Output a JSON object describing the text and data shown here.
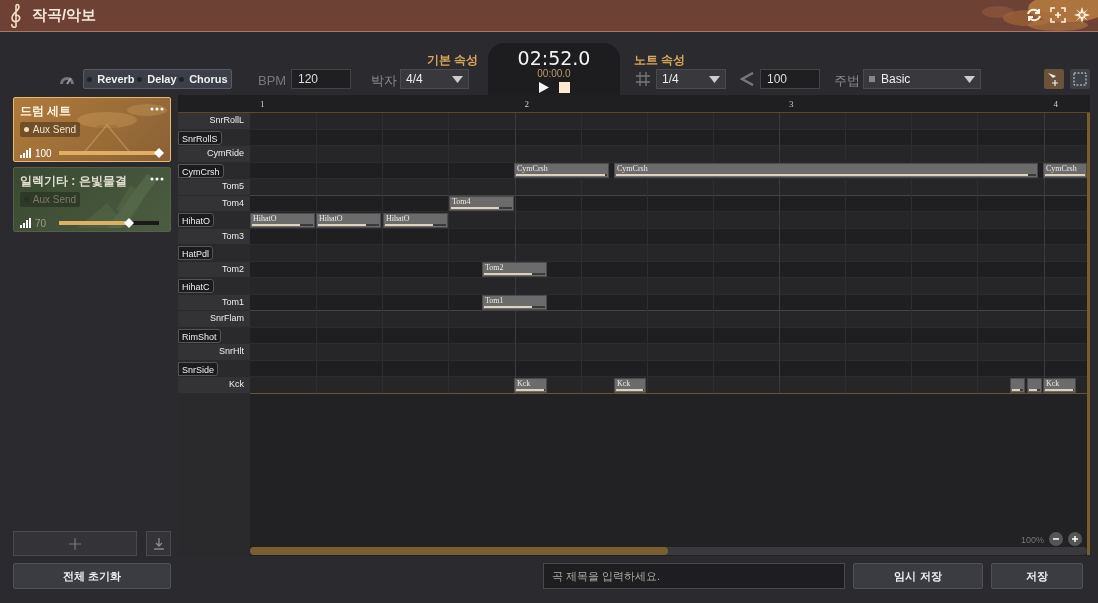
{
  "window": {
    "title": "작곡/악보"
  },
  "effects": [
    {
      "label": "Reverb",
      "on": false
    },
    {
      "label": "Delay",
      "on": false
    },
    {
      "label": "Chorus",
      "on": false
    }
  ],
  "bpm": {
    "label": "BPM",
    "value": "120"
  },
  "meter": {
    "label": "박자",
    "value": "4/4"
  },
  "basic_header": "기본 속성",
  "transport": {
    "time": "02:52.0",
    "position": "00:00.0"
  },
  "note_header": "노트 속성",
  "grid_value": "1/4",
  "velocity": "100",
  "technique": {
    "label": "주법",
    "value": "Basic"
  },
  "tools": [
    {
      "kind": "pointer",
      "selected": true
    },
    {
      "kind": "marquee",
      "selected": false
    }
  ],
  "tracks": [
    {
      "name": "드럼 세트",
      "kind": "drums",
      "selected": true,
      "aux": {
        "label": "Aux Send",
        "on": true
      },
      "volume": "100",
      "level": 1.0
    },
    {
      "name": "일렉기타 : 은빛물결",
      "kind": "guitar",
      "selected": false,
      "aux": {
        "label": "Aux Send",
        "on": false
      },
      "volume": "70",
      "level": 0.7
    }
  ],
  "ruler": [
    "1",
    "2",
    "3",
    "4"
  ],
  "rows": [
    {
      "label": "SnrRollL",
      "kind": "white"
    },
    {
      "label": "SnrRollS",
      "kind": "black"
    },
    {
      "label": "CymRide",
      "kind": "white"
    },
    {
      "label": "CymCrsh",
      "kind": "black",
      "notes": [
        {
          "label": "CymCrsh",
          "level": 0.98
        },
        {
          "label": "CymCrsh",
          "level": 0.98
        },
        {
          "label": "CymCrsh",
          "level": 1.0
        }
      ]
    },
    {
      "label": "Tom5",
      "kind": "white"
    },
    {
      "label": "Tom4",
      "kind": "white",
      "notes": [
        {
          "label": "Tom4",
          "level": 0.78
        }
      ]
    },
    {
      "label": "HihatO",
      "kind": "black",
      "notes": [
        {
          "label": "HihatO",
          "level": 0.78
        },
        {
          "label": "HihatO",
          "level": 0.78
        },
        {
          "label": "HihatO",
          "level": 0.78
        }
      ]
    },
    {
      "label": "Tom3",
      "kind": "white"
    },
    {
      "label": "HatPdl",
      "kind": "black"
    },
    {
      "label": "Tom2",
      "kind": "white",
      "notes": [
        {
          "label": "Tom2",
          "level": 0.78
        }
      ]
    },
    {
      "label": "HihatC",
      "kind": "black"
    },
    {
      "label": "Tom1",
      "kind": "white",
      "notes": [
        {
          "label": "Tom1",
          "level": 0.78
        }
      ]
    },
    {
      "label": "SnrFlam",
      "kind": "white"
    },
    {
      "label": "RimShot",
      "kind": "black"
    },
    {
      "label": "SnrHlt",
      "kind": "white"
    },
    {
      "label": "SnrSide",
      "kind": "black"
    },
    {
      "label": "Kck",
      "kind": "white",
      "notes": [
        {
          "label": "Kck",
          "level": 0.98
        },
        {
          "label": "Kck",
          "level": 0.98
        },
        {
          "kind": "blank"
        },
        {
          "kind": "blank"
        },
        {
          "label": "Kck",
          "level": 0.98
        }
      ]
    }
  ],
  "zoom": "100%",
  "footer": {
    "reset": "전체 초기화",
    "title_placeholder": "곡 제목을 입력하세요.",
    "temp_save": "임시 저장",
    "save": "저장"
  }
}
